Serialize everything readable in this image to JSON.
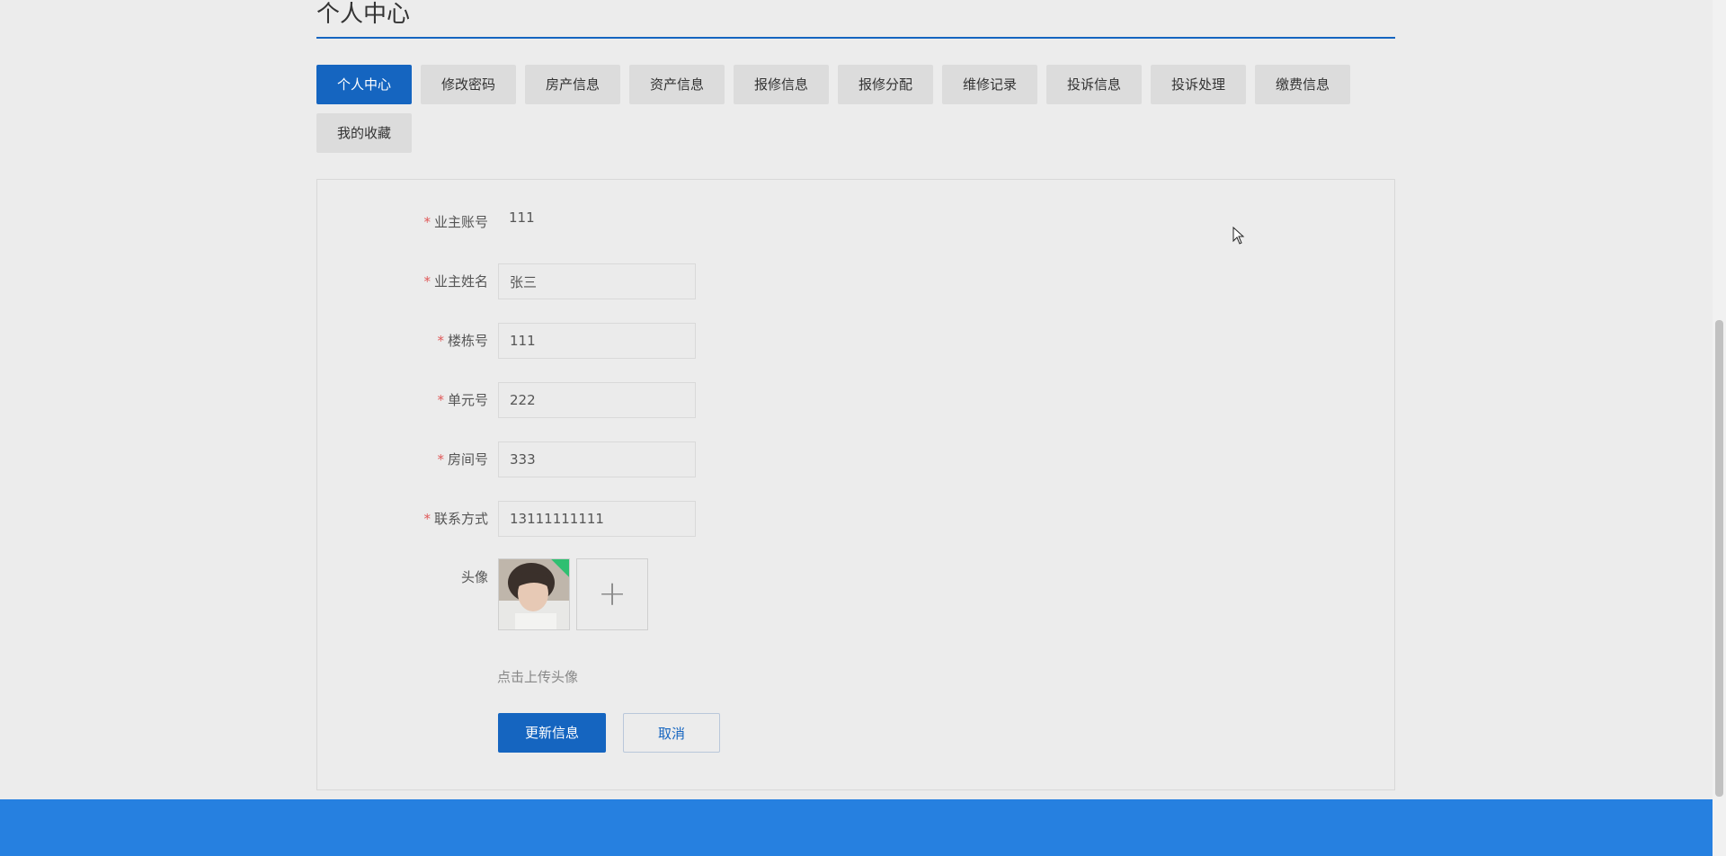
{
  "page_title": "个人中心",
  "tabs": [
    {
      "label": "个人中心",
      "active": true
    },
    {
      "label": "修改密码",
      "active": false
    },
    {
      "label": "房产信息",
      "active": false
    },
    {
      "label": "资产信息",
      "active": false
    },
    {
      "label": "报修信息",
      "active": false
    },
    {
      "label": "报修分配",
      "active": false
    },
    {
      "label": "维修记录",
      "active": false
    },
    {
      "label": "投诉信息",
      "active": false
    },
    {
      "label": "投诉处理",
      "active": false
    },
    {
      "label": "缴费信息",
      "active": false
    },
    {
      "label": "我的收藏",
      "active": false
    }
  ],
  "form": {
    "owner_account": {
      "label": "业主账号",
      "value": "111"
    },
    "owner_name": {
      "label": "业主姓名",
      "value": "张三"
    },
    "building_no": {
      "label": "楼栋号",
      "value": "111"
    },
    "unit_no": {
      "label": "单元号",
      "value": "222"
    },
    "room_no": {
      "label": "房间号",
      "value": "333"
    },
    "contact": {
      "label": "联系方式",
      "value": "13111111111"
    },
    "avatar": {
      "label": "头像",
      "upload_hint": "点击上传头像"
    },
    "required_mark": "*"
  },
  "buttons": {
    "update": "更新信息",
    "cancel": "取消"
  },
  "colors": {
    "primary": "#1565c0",
    "footer": "#2680e0",
    "required": "#e05a5a",
    "upload_success": "#2fbf71"
  },
  "icons": {
    "upload": "plus-icon",
    "upload_status": "check-icon"
  }
}
